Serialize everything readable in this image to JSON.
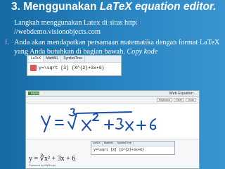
{
  "slide": {
    "title_prefix": "3. Menggunakan ",
    "title_em": "LaTeX equation editor.",
    "para1": "Langkah menggunakan Latex di situs http: //webdemo.visionobjects.com",
    "bullet": "f.",
    "para2_plain": "Anda akan mendapatkan persamaan matematika dengan format LaTeX yang Anda butuhkan di bagian bawah. ",
    "para2_italic": "Copy kode"
  },
  "mini_toolbar": {
    "tabs": [
      "LaTeX",
      "MathML",
      "SymbolTree"
    ],
    "code": "y=\\sqrt [3] {X^{2}+3x+6}"
  },
  "web_equation": {
    "logo": "MyScript",
    "heading": "Web Equation",
    "tool_buttons": [
      "Keyboard",
      "Clear",
      "Undo"
    ],
    "tabs": [
      "LaTeX",
      "MathML",
      "SymbolTree"
    ],
    "code": "y=\\sqrt [3] {X^{2}+3x+6}",
    "rendered": "y = ∛x² + 3x + 6",
    "powered": "Powered by MyScript"
  },
  "colors": {
    "background": "#1f78b4",
    "title": "#ffffff"
  }
}
